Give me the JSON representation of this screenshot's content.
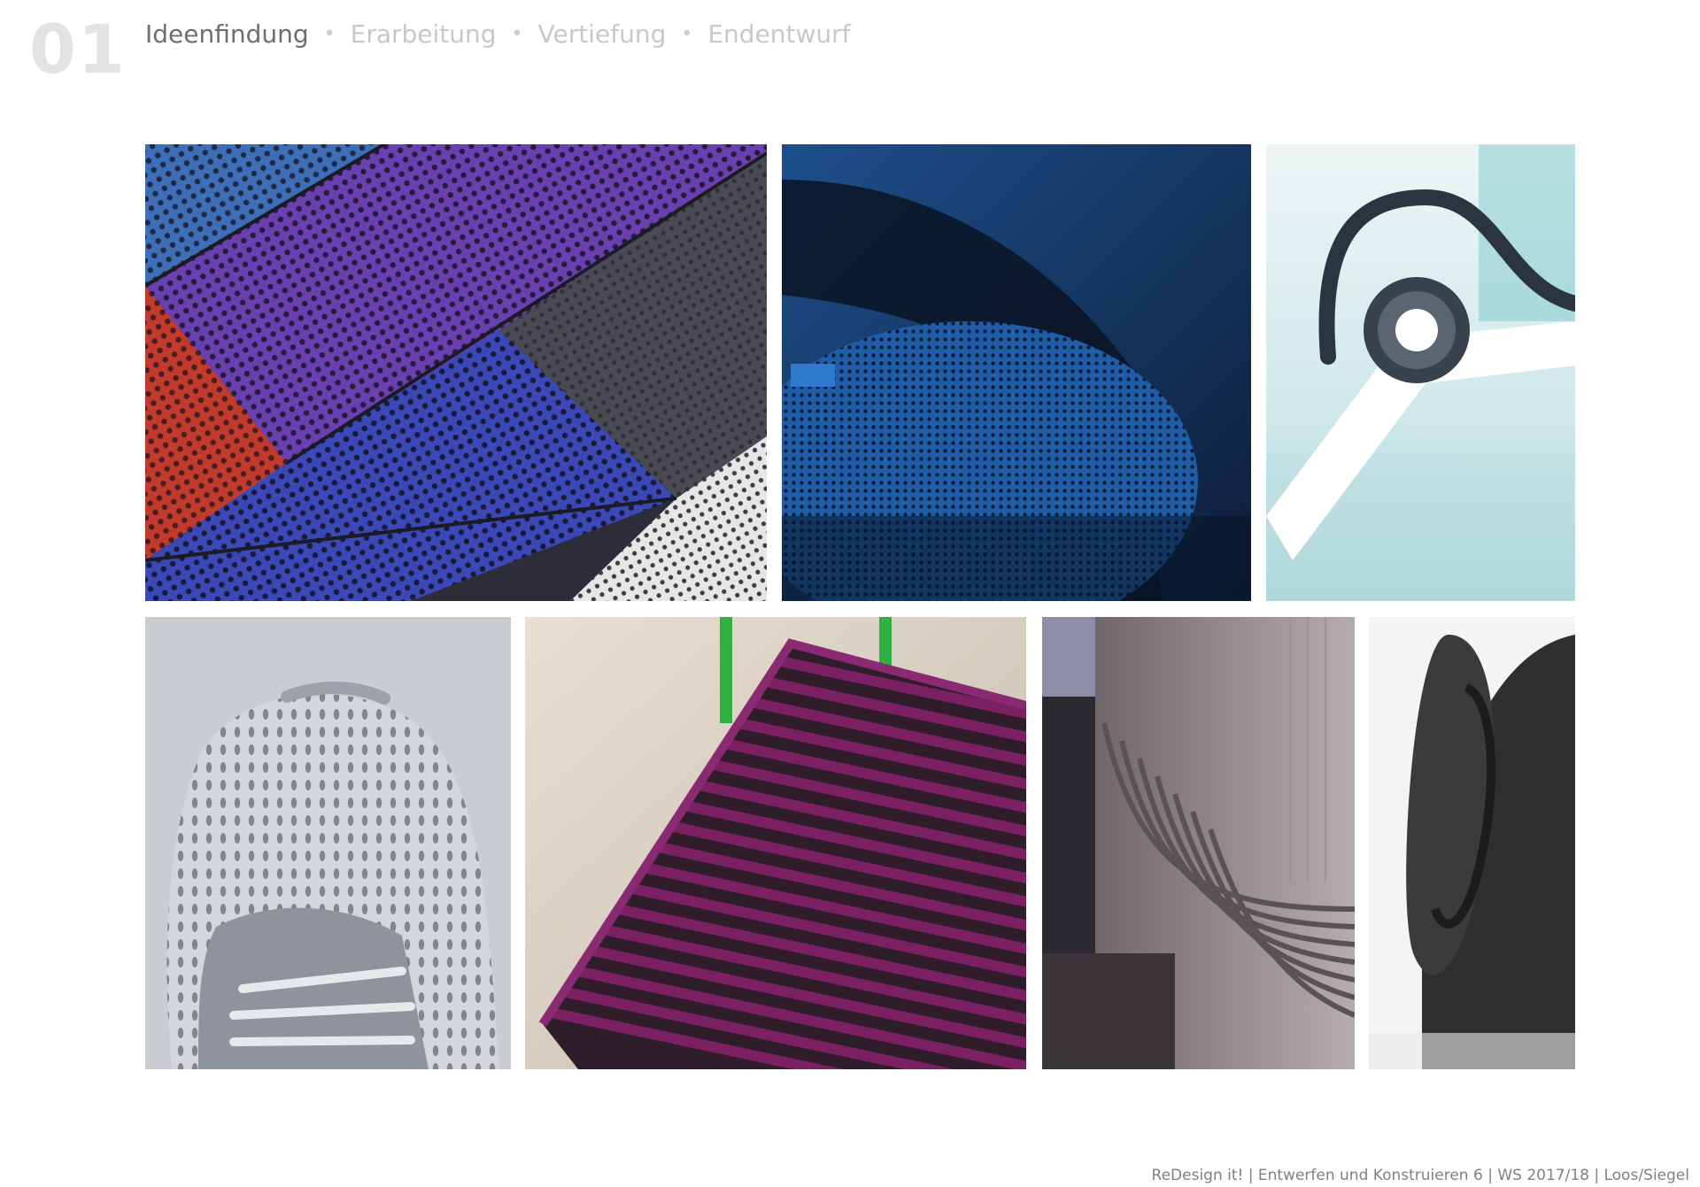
{
  "header": {
    "page_number": "01",
    "steps": [
      {
        "label": "Ideenfindung",
        "active": true
      },
      {
        "label": "Erarbeitung",
        "active": false
      },
      {
        "label": "Vertiefung",
        "active": false
      },
      {
        "label": "Endentwurf",
        "active": false
      }
    ],
    "separator": "•"
  },
  "moodboard": {
    "images": [
      {
        "subject": "perforated colorful speaker panels",
        "colors": [
          "#6a3fb0",
          "#3a48b8",
          "#c23a2c",
          "#3d6fb8",
          "#3c3c44"
        ]
      },
      {
        "subject": "blue perforated speaker closeup",
        "colors": [
          "#123a6a",
          "#1d4f8c",
          "#0d1d36"
        ]
      },
      {
        "subject": "headphone hinge detail",
        "colors": [
          "#dfeff0",
          "#2e3a44",
          "#ffffff"
        ]
      },
      {
        "subject": "knit sneaker upper",
        "colors": [
          "#c4c8cc",
          "#8f969c",
          "#e3e6e8"
        ]
      },
      {
        "subject": "purple slatted bench",
        "colors": [
          "#7a2063",
          "#2f1d2a",
          "#d8cfc1",
          "#30b040"
        ]
      },
      {
        "subject": "layered stone facade architecture",
        "colors": [
          "#a79ea0",
          "#6f6769",
          "#2d2a2f"
        ]
      },
      {
        "subject": "dark round speaker",
        "colors": [
          "#2e2f31",
          "#f4f4f4",
          "#111213"
        ]
      }
    ]
  },
  "footer": {
    "text": "ReDesign it! | Entwerfen und Konstruieren 6 | WS 2017/18 | Loos/Siegel"
  }
}
